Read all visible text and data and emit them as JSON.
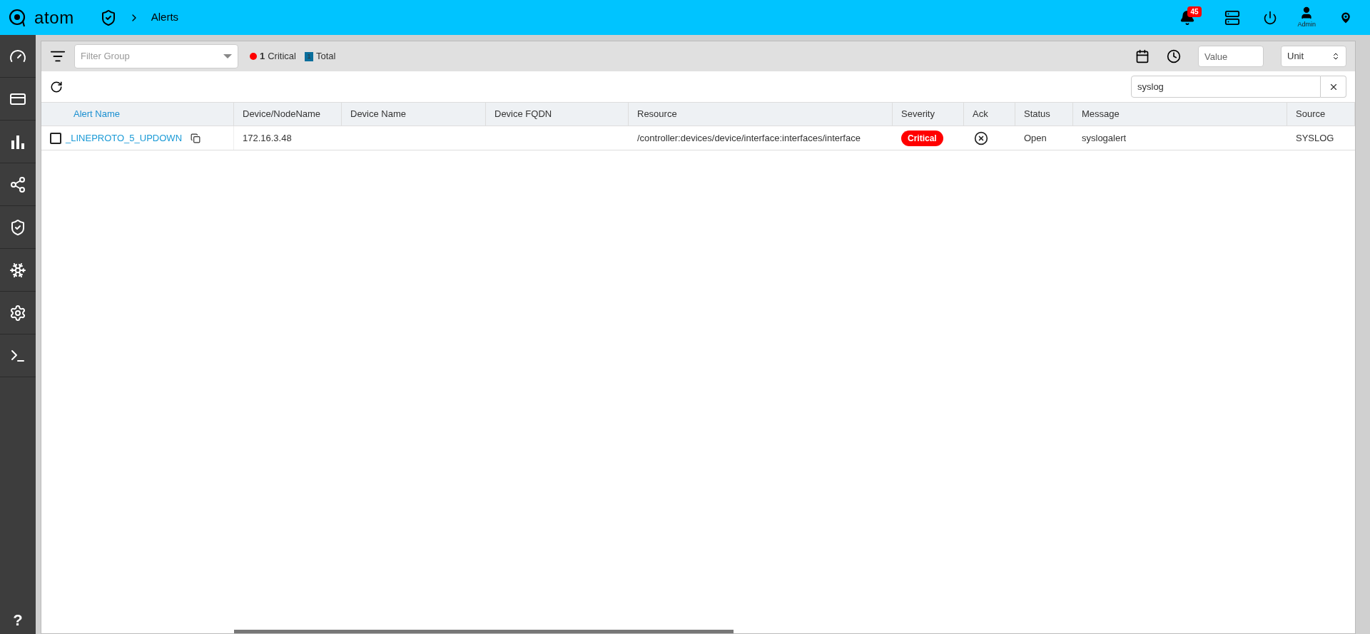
{
  "app": {
    "logo": "atom",
    "breadcrumb": "Alerts",
    "notifications": "45",
    "user": "Admin"
  },
  "sidebar": {
    "items": [
      {
        "kind": "dashboard"
      },
      {
        "kind": "cards"
      },
      {
        "kind": "chart"
      },
      {
        "kind": "network"
      },
      {
        "kind": "shield"
      },
      {
        "kind": "snowflake"
      },
      {
        "kind": "settings"
      },
      {
        "kind": "terminal"
      }
    ],
    "help": "?"
  },
  "filter_bar": {
    "group_placeholder": "Filter Group",
    "critical": {
      "count": "1",
      "label": "Critical",
      "color": "#ff0000"
    },
    "total": {
      "count": "1",
      "label": "Total",
      "color": "#0a6e9c"
    },
    "value_placeholder": "Value",
    "unit": "Unit"
  },
  "search": {
    "value": "syslog"
  },
  "table": {
    "columns": [
      {
        "label": "Alert Name",
        "sorted": true
      },
      {
        "label": "Device/NodeName",
        "sorted": false
      },
      {
        "label": "Device Name",
        "sorted": false
      },
      {
        "label": "Device FQDN",
        "sorted": false
      },
      {
        "label": "Resource",
        "sorted": false
      },
      {
        "label": "Severity",
        "sorted": false
      },
      {
        "label": "Ack",
        "sorted": false
      },
      {
        "label": "Status",
        "sorted": false
      },
      {
        "label": "Message",
        "sorted": false
      },
      {
        "label": "Source",
        "sorted": false
      }
    ],
    "rows": [
      {
        "checked": false,
        "alert_name": "_LINEPROTO_5_UPDOWN",
        "node": "172.16.3.48",
        "resource": "/controller:devices/device/interface:interfaces/interface",
        "severity": {
          "label": "Critical",
          "color": "#ff0000"
        },
        "acknowledged": false,
        "status": "Open",
        "message": "syslogalert",
        "source": "SYSLOG"
      }
    ]
  }
}
